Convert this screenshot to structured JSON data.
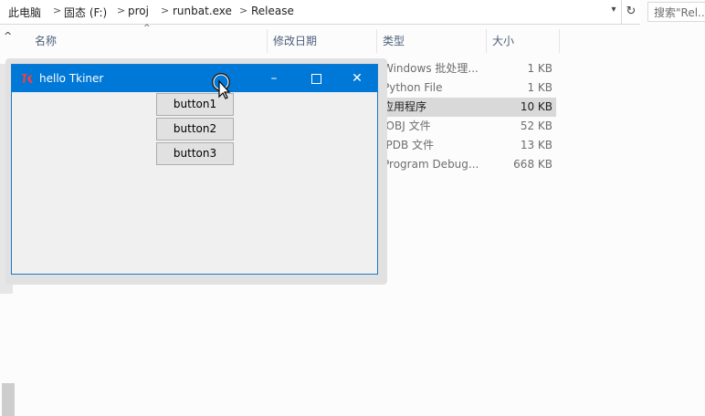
{
  "address_bar": {
    "crumbs": [
      "此电脑",
      "固态 (F:)",
      "proj",
      "runbat.exe",
      "Release"
    ],
    "separator": ">"
  },
  "search": {
    "placeholder": "搜索\"Rel..."
  },
  "columns": {
    "name": "名称",
    "modified": "修改日期",
    "type": "类型",
    "size": "大小"
  },
  "files": [
    {
      "type": "Windows 批处理...",
      "size": "1 KB",
      "selected": false
    },
    {
      "type": "Python File",
      "size": "1 KB",
      "selected": false
    },
    {
      "type": "应用程序",
      "size": "10 KB",
      "selected": true
    },
    {
      "type": "IOBJ 文件",
      "size": "52 KB",
      "selected": false
    },
    {
      "type": "IPDB 文件",
      "size": "13 KB",
      "selected": false
    },
    {
      "type": "Program Debug...",
      "size": "668 KB",
      "selected": false
    }
  ],
  "tk_window": {
    "title": "hello Tkiner",
    "buttons": [
      "button1",
      "button2",
      "button3"
    ],
    "accent": "#0078d7"
  }
}
